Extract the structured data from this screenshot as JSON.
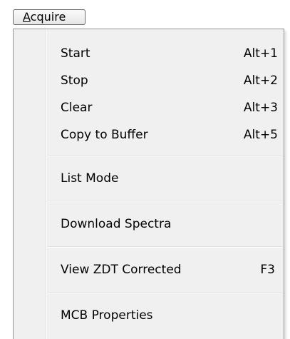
{
  "menubar": {
    "acquire_mnemonic": "A",
    "acquire_rest": "cquire"
  },
  "menu": {
    "start": {
      "label": "Start",
      "shortcut": "Alt+1"
    },
    "stop": {
      "label": "Stop",
      "shortcut": "Alt+2"
    },
    "clear": {
      "label": "Clear",
      "shortcut": "Alt+3"
    },
    "copy_to_buffer": {
      "label": "Copy to Buffer",
      "shortcut": "Alt+5"
    },
    "list_mode": {
      "label": "List Mode"
    },
    "download_spectra": {
      "label": "Download Spectra"
    },
    "view_zdt_corrected": {
      "label": "View ZDT Corrected",
      "shortcut": "F3"
    },
    "mcb_properties": {
      "label": "MCB Properties"
    }
  },
  "colors": {
    "menu_background": "#f0f0f0",
    "menu_border": "#979797",
    "separator": "#e0e0e0"
  }
}
